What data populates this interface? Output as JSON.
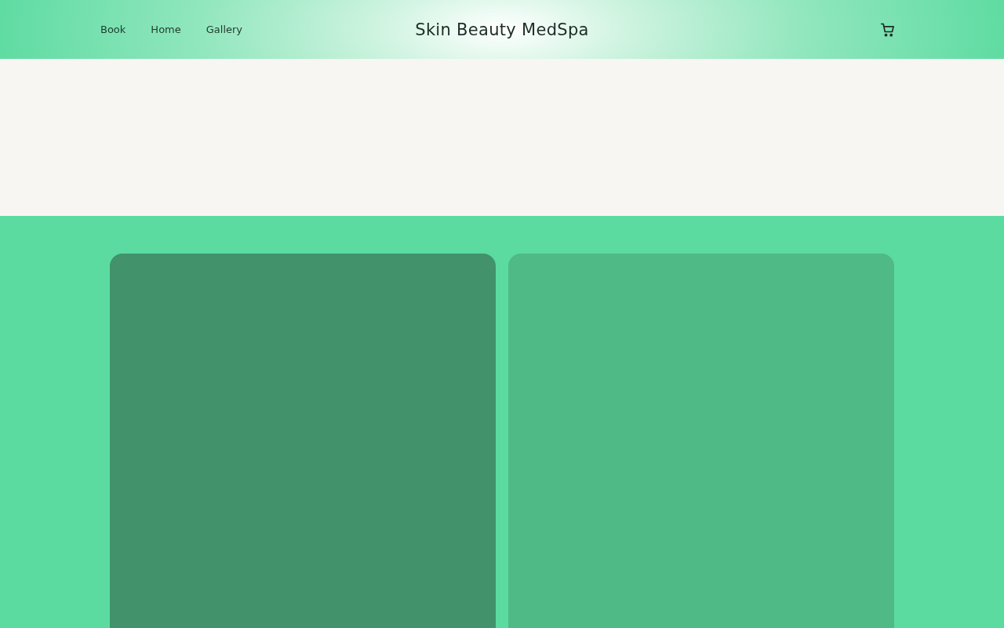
{
  "header": {
    "nav": [
      {
        "label": "Book"
      },
      {
        "label": "Home"
      },
      {
        "label": "Gallery"
      }
    ],
    "brand": "Skin Beauty MedSpa"
  },
  "cards": [
    {
      "color": "#42926c"
    },
    {
      "color": "#4fba86"
    }
  ]
}
